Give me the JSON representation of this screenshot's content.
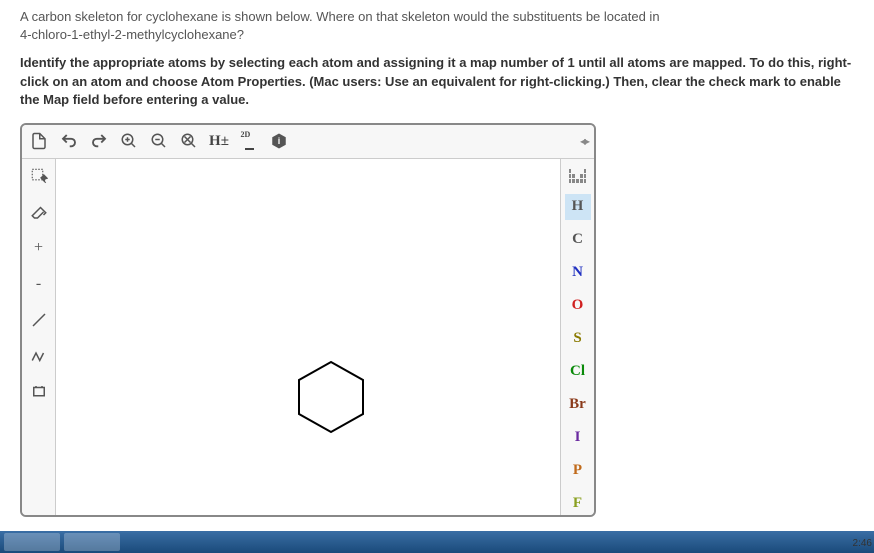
{
  "question": {
    "line1": "A carbon skeleton for cyclohexane is shown below. Where on that skeleton would the substituents be located in",
    "line2": "4-chloro-1-ethyl-2-methylcyclohexane?"
  },
  "instruction": "Identify the appropriate atoms by selecting each atom and assigning it a map number of 1 until all atoms are mapped. To do this, right-click on an atom and choose Atom Properties. (Mac users: Use an equivalent for right-clicking.) Then, clear the check mark to enable the Map field before entering a value.",
  "toolbar_top": {
    "h_label": "H±",
    "two_d_sup": "2D"
  },
  "toolbar_left": {
    "plus": "+",
    "minus": "-"
  },
  "elements": {
    "H": "H",
    "C": "C",
    "N": "N",
    "O": "O",
    "S": "S",
    "Cl": "Cl",
    "Br": "Br",
    "I": "I",
    "P": "P",
    "F": "F"
  },
  "taskbar": {
    "time": "2:46"
  }
}
